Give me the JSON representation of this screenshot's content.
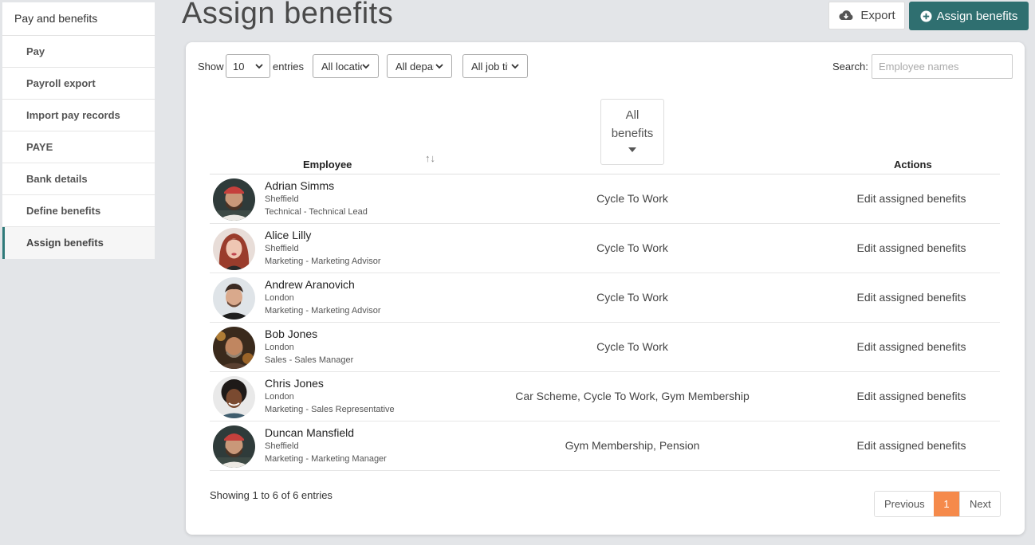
{
  "sidebar": {
    "title": "Pay and benefits",
    "items": [
      {
        "label": "Pay"
      },
      {
        "label": "Payroll export"
      },
      {
        "label": "Import pay records"
      },
      {
        "label": "PAYE"
      },
      {
        "label": "Bank details"
      },
      {
        "label": "Define benefits"
      },
      {
        "label": "Assign benefits"
      }
    ],
    "accent": "#2f7a7a"
  },
  "header": {
    "title": "Assign benefits",
    "export_label": "Export",
    "assign_label": "Assign benefits",
    "assign_color": "#2f6f70"
  },
  "controls": {
    "show_label": "Show",
    "entries_value": "10",
    "entries_label": "entries",
    "location_filter": "All locations",
    "department_filter": "All departments",
    "job_filter": "All job titles",
    "search_label": "Search:",
    "search_placeholder": "Employee names"
  },
  "table": {
    "col_employee": "Employee",
    "sort_icon": "↑↓",
    "benefits_filter_line1": "All",
    "benefits_filter_line2": "benefits",
    "col_actions": "Actions",
    "rows": [
      {
        "name": "Adrian Simms",
        "location": "Sheffield",
        "role": "Technical - Technical Lead",
        "benefits": "Cycle To Work",
        "action": "Edit assigned benefits"
      },
      {
        "name": "Alice Lilly",
        "location": "Sheffield",
        "role": "Marketing - Marketing Advisor",
        "benefits": "Cycle To Work",
        "action": "Edit assigned benefits"
      },
      {
        "name": "Andrew Aranovich",
        "location": "London",
        "role": "Marketing - Marketing Advisor",
        "benefits": "Cycle To Work",
        "action": "Edit assigned benefits"
      },
      {
        "name": "Bob Jones",
        "location": "London",
        "role": "Sales - Sales Manager",
        "benefits": "Cycle To Work",
        "action": "Edit assigned benefits"
      },
      {
        "name": "Chris Jones",
        "location": "London",
        "role": "Marketing - Sales Representative",
        "benefits": "Car Scheme, Cycle To Work, Gym Membership",
        "action": "Edit assigned benefits"
      },
      {
        "name": "Duncan Mansfield",
        "location": "Sheffield",
        "role": "Marketing - Marketing Manager",
        "benefits": "Gym Membership, Pension",
        "action": "Edit assigned benefits"
      }
    ]
  },
  "footer": {
    "info": "Showing 1 to 6 of 6 entries",
    "prev": "Previous",
    "current_page": "1",
    "next": "Next",
    "current_color": "#f58a4b"
  }
}
